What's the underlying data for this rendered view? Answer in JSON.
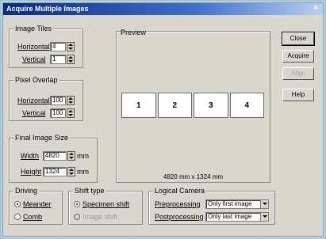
{
  "window": {
    "title": "Acquire Multiple Images"
  },
  "tiles_group": {
    "legend": "Image Tiles",
    "horizontal_label": "Horizontal",
    "horizontal_value": "4",
    "vertical_label": "Vertical",
    "vertical_value": "1"
  },
  "overlap_group": {
    "legend": "Pixel Overlap",
    "horizontal_label": "Horizontal",
    "horizontal_value": "100",
    "vertical_label": "Vertical",
    "vertical_value": "100"
  },
  "final_size_group": {
    "legend": "Final Image Size",
    "width_label": "Width",
    "width_value": "4820",
    "width_unit": "mm",
    "height_label": "Height",
    "height_value": "1324",
    "height_unit": "mm"
  },
  "preview": {
    "label": "Preview",
    "tiles": [
      "1",
      "2",
      "3",
      "4"
    ],
    "size_readout": "4820 mm x 1324 mm"
  },
  "buttons": {
    "close": "Close",
    "acquire": "Acquire",
    "align": "Align",
    "help": "Help"
  },
  "driving_group": {
    "legend": "Driving",
    "meander": "Meander",
    "comb": "Comb"
  },
  "shift_group": {
    "legend": "Shift type",
    "specimen": "Specimen shift",
    "image": "Image shift"
  },
  "logical_camera_group": {
    "legend": "Logical Camera",
    "pre_label": "Preprocessing",
    "pre_value": "Only first image",
    "post_label": "Postprocessing",
    "post_value": "Only last image"
  }
}
